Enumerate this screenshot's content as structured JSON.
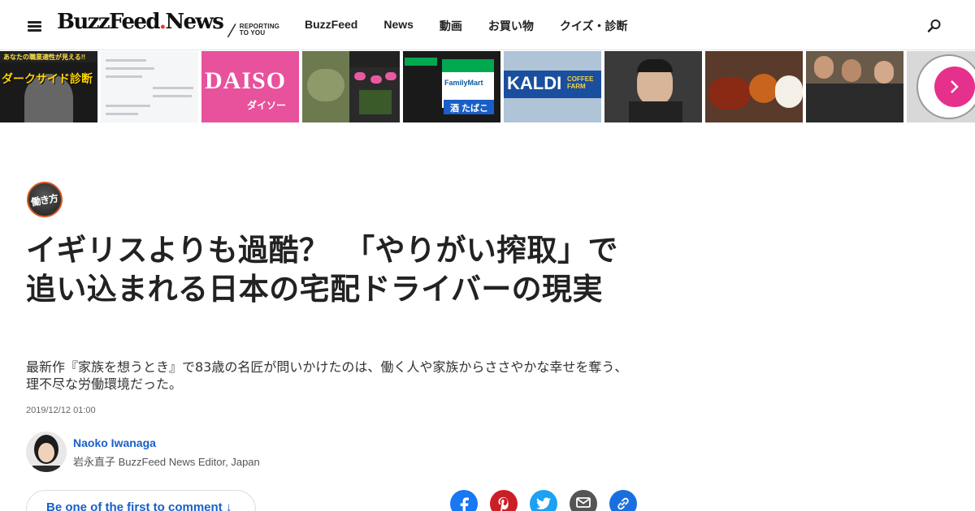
{
  "header": {
    "logo_main": "BuzzFeed",
    "logo_dot": ".",
    "logo_news": "News",
    "tagline_slash": "/",
    "tagline": "REPORTING TO YOU",
    "nav": [
      "BuzzFeed",
      "News",
      "動画",
      "お買い物",
      "クイズ・診断"
    ]
  },
  "thumbnails": {
    "items": [
      {
        "name": "dark-side-quiz",
        "line1": "あなたの職業適性が見える!!",
        "line2": "ダークサイド診断"
      },
      {
        "name": "tweet-screens",
        "line1": "",
        "line2": ""
      },
      {
        "name": "daiso",
        "line1": "DAISO",
        "line2": "ダイソー"
      },
      {
        "name": "baby-yoda",
        "line1": "",
        "line2": ""
      },
      {
        "name": "familymart",
        "line1": "FamilyMart",
        "line2": "酒 たばこ"
      },
      {
        "name": "kaldi",
        "line1": "KALDI",
        "line2": "COFFEE FARM"
      },
      {
        "name": "man-portrait",
        "line1": "",
        "line2": ""
      },
      {
        "name": "curry",
        "line1": "",
        "line2": ""
      },
      {
        "name": "group-photo",
        "line1": "",
        "line2": ""
      },
      {
        "name": "clock",
        "line1": "",
        "line2": ""
      }
    ]
  },
  "colors": {
    "accent_blue": "#1a5ec8",
    "brand_red": "#e32",
    "carousel_pink": "#e5318c",
    "facebook": "#1877f2",
    "pinterest": "#cb1f27",
    "twitter": "#1da1f2",
    "email": "#555555",
    "link": "#1a6fe0"
  },
  "article": {
    "badge": "働き方",
    "title": "イギリスよりも過酷？　「やりがい搾取」で追い込まれる日本の宅配ドライバーの現実",
    "subtitle": "最新作『家族を想うとき』で83歳の名匠が問いかけたのは、働く人や家族からささやかな幸せを奪う、理不尽な労働環境だった。",
    "date": "2019/12/12 01:00",
    "author_name": "Naoko Iwanaga",
    "author_role": "岩永直子 BuzzFeed News Editor, Japan",
    "comment_cta": "Be one of the first to comment ↓"
  },
  "share": {
    "icons": [
      "facebook-icon",
      "pinterest-icon",
      "twitter-icon",
      "email-icon",
      "link-icon"
    ]
  }
}
